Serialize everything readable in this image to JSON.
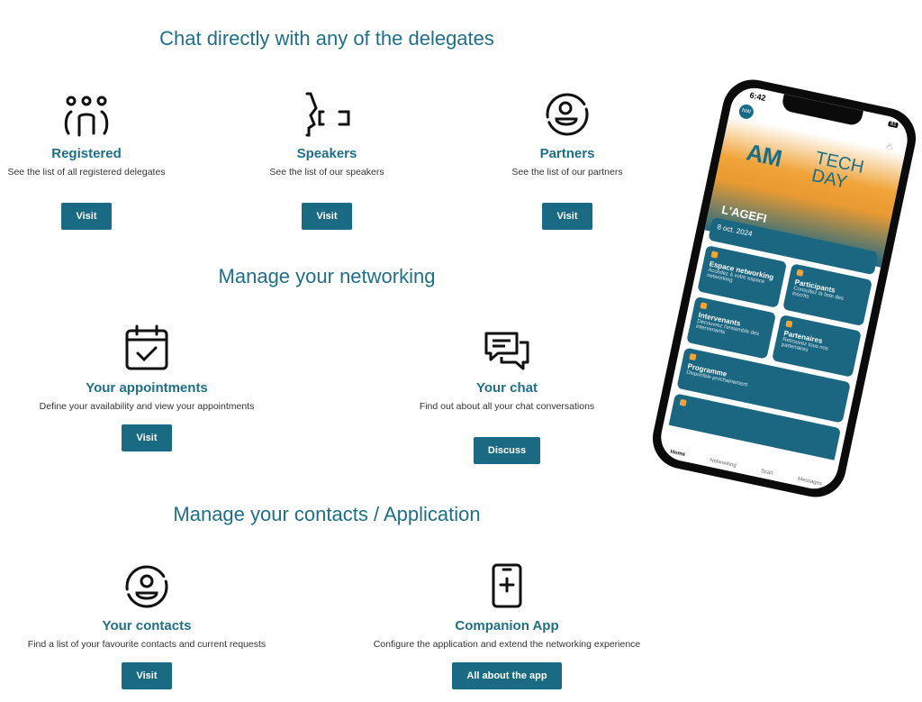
{
  "sections": [
    {
      "title": "Chat directly with any of the delegates",
      "cards": [
        {
          "icon": "users-group-icon",
          "title": "Registered",
          "desc": "See the list of all registered delegates",
          "button": "Visit"
        },
        {
          "icon": "speaker-icon",
          "title": "Speakers",
          "desc": "See the list of our speakers",
          "button": "Visit"
        },
        {
          "icon": "partner-user-circle-icon",
          "title": "Partners",
          "desc": "See the list of our partners",
          "button": "Visit"
        }
      ]
    },
    {
      "title": "Manage your networking",
      "cards": [
        {
          "icon": "calendar-check-icon",
          "title": "Your appointments",
          "desc": "Define your availability and view your appointments",
          "button": "Visit"
        },
        {
          "icon": "chat-bubbles-icon",
          "title": "Your chat",
          "desc": "Find out about all your chat conversations",
          "button": "Discuss"
        }
      ]
    },
    {
      "title": "Manage your contacts / Application",
      "cards": [
        {
          "icon": "contact-user-circle-icon",
          "title": "Your contacts",
          "desc": "Find a list of your favourite contacts and current requests",
          "button": "Visit"
        },
        {
          "icon": "phone-plus-icon",
          "title": "Companion App",
          "desc": "Configure the application and extend the networking experience",
          "button": "All about the app"
        }
      ]
    }
  ],
  "phone": {
    "time": "6:42",
    "battery": "81",
    "avatar": "NW",
    "logo_a": "AM",
    "logo_b": "TECH DAY",
    "banner_text": "L'AGEFI",
    "date": "8 oct. 2024",
    "tiles": [
      {
        "title": "Espace networking",
        "desc": "Accédez à votre espace networking"
      },
      {
        "title": "Participants",
        "desc": "Consultez la liste des inscrits"
      },
      {
        "title": "Intervenants",
        "desc": "Découvrez l'ensemble des intervenants"
      },
      {
        "title": "Partenaires",
        "desc": "Retrouvez tous nos partenaires"
      },
      {
        "title": "Programme",
        "desc": "Disponible prochainement"
      }
    ],
    "tabs": [
      "Home",
      "Networking",
      "Scan",
      "Messages"
    ]
  },
  "colors": {
    "accent": "#1f6f88",
    "button": "#1b6a84",
    "highlight": "#f0a43a"
  }
}
